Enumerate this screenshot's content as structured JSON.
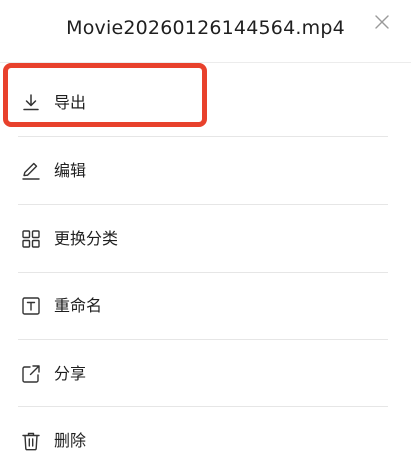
{
  "header": {
    "title": "Movie20260126144564.mp4",
    "close_icon": "close-icon"
  },
  "menu": {
    "items": [
      {
        "label": "导出",
        "icon": "export-icon"
      },
      {
        "label": "编辑",
        "icon": "edit-icon"
      },
      {
        "label": "更换分类",
        "icon": "grid-icon"
      },
      {
        "label": "重命名",
        "icon": "rename-icon"
      },
      {
        "label": "分享",
        "icon": "share-icon"
      },
      {
        "label": "删除",
        "icon": "trash-icon"
      }
    ]
  },
  "colors": {
    "highlight": "#e8412c",
    "text": "#1f1f1f",
    "icon": "#333333",
    "divider": "#e6e6e6"
  }
}
